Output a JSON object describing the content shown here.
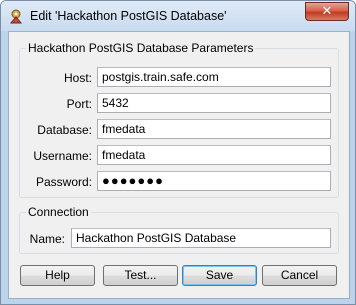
{
  "window": {
    "title": "Edit 'Hackathon PostGIS Database'",
    "icon": "fme-workbench-icon",
    "close_label": "✕"
  },
  "parameters": {
    "legend": "Hackathon PostGIS Database Parameters",
    "host_label": "Host:",
    "host_value": "postgis.train.safe.com",
    "port_label": "Port:",
    "port_value": "5432",
    "database_label": "Database:",
    "database_value": "fmedata",
    "username_label": "Username:",
    "username_value": "fmedata",
    "password_label": "Password:",
    "password_value": "●●●●●●●"
  },
  "connection": {
    "legend": "Connection",
    "name_label": "Name:",
    "name_value": "Hackathon PostGIS Database"
  },
  "buttons": {
    "help": "Help",
    "test": "Test...",
    "save": "Save",
    "cancel": "Cancel"
  }
}
